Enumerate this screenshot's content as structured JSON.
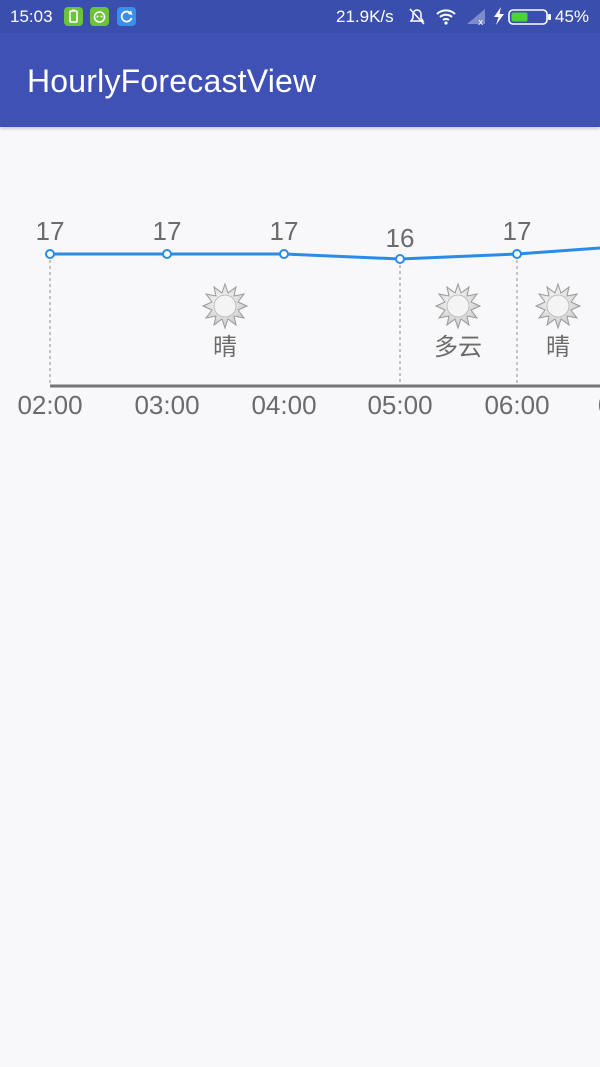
{
  "status_bar": {
    "time": "15:03",
    "network_speed": "21.9K/s",
    "battery_percent": "45%",
    "icons": [
      "battery-saver-icon",
      "android-app-icon",
      "sync-app-icon",
      "mute-notifications-icon",
      "wifi-icon",
      "signal-icon",
      "charging-icon",
      "battery-icon"
    ]
  },
  "app_bar": {
    "title": "HourlyForecastView"
  },
  "forecast": {
    "hours": [
      "02:00",
      "03:00",
      "04:00",
      "05:00",
      "06:00",
      "0"
    ],
    "temperatures": [
      17,
      17,
      17,
      16,
      17
    ],
    "conditions": [
      {
        "label": "晴",
        "icon": "sunny-icon"
      },
      {
        "label": "多云",
        "icon": "cloudy-icon"
      },
      {
        "label": "晴",
        "icon": "sunny-icon"
      }
    ],
    "colors": {
      "line": "#2a8ce6",
      "axis": "#757575",
      "divider": "#8f8f8f",
      "text": "#6b6b6b"
    }
  }
}
